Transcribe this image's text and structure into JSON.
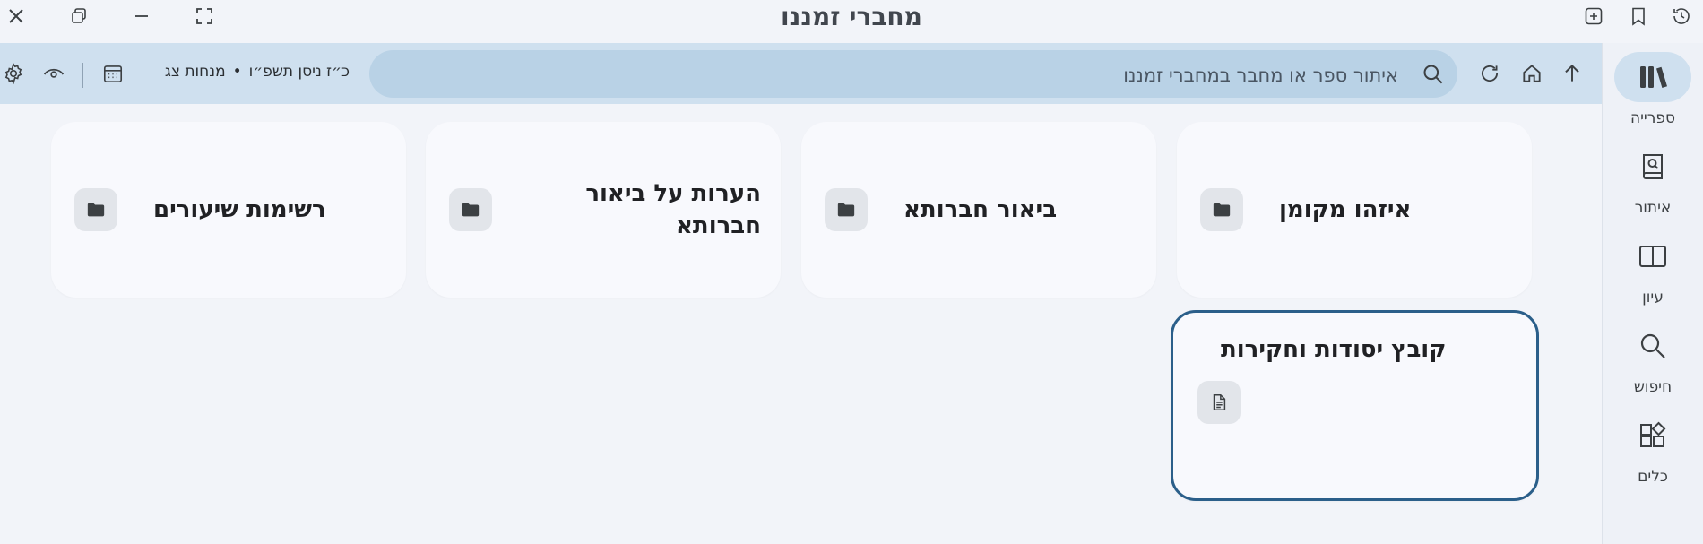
{
  "window": {
    "title": "מחברי זמננו"
  },
  "sidebar": {
    "items": [
      {
        "label": "ספרייה",
        "icon": "library-icon",
        "active": true
      },
      {
        "label": "איתור",
        "icon": "find-book-icon",
        "active": false
      },
      {
        "label": "עיון",
        "icon": "open-book-icon",
        "active": false
      },
      {
        "label": "חיפוש",
        "icon": "search-icon",
        "active": false
      },
      {
        "label": "כלים",
        "icon": "tools-icon",
        "active": false
      }
    ]
  },
  "toolbar": {
    "search_placeholder": "איתור ספר או מחבר במחברי זמננו",
    "hebrew_date": "כ״ז ניסן תשפ״ו",
    "separator": "•",
    "omer_text": "מנחות צג"
  },
  "cards": [
    {
      "label": "איזהו מקומן",
      "kind": "folder"
    },
    {
      "label": "ביאור חברותא",
      "kind": "folder"
    },
    {
      "label": "הערות על ביאור חברותא",
      "kind": "folder"
    },
    {
      "label": "רשימות שיעורים",
      "kind": "folder"
    },
    {
      "label": "קובץ יסודות וחקירות",
      "kind": "file"
    }
  ],
  "colors": {
    "toolbar_bg": "#cfe0ef",
    "search_bg": "#b9d2e6",
    "selected_border": "#2b5f8a",
    "card_bg": "#f8f9fd",
    "page_bg": "#f2f4f9"
  }
}
